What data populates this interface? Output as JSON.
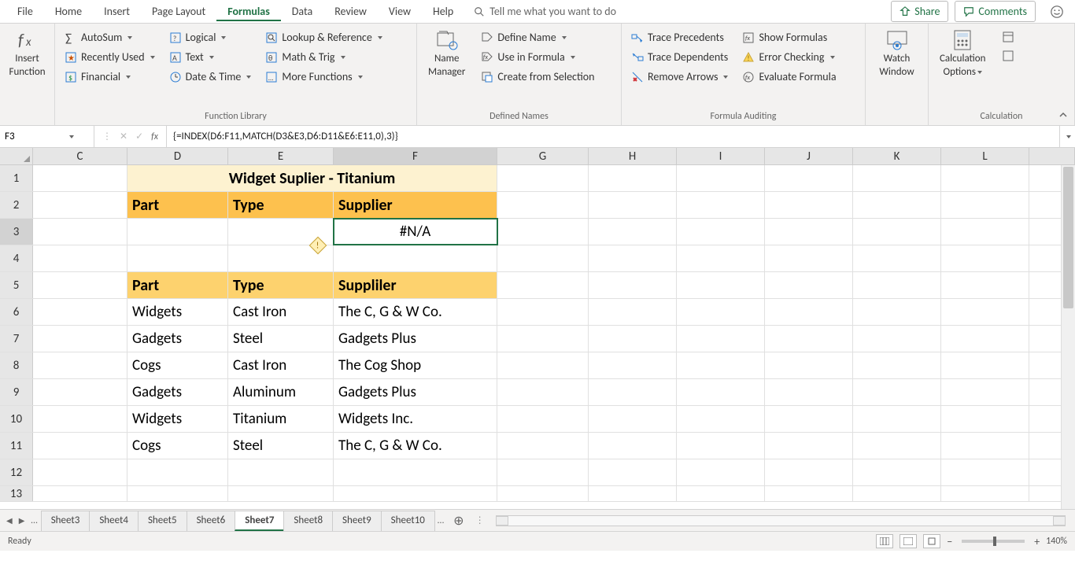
{
  "menu": {
    "file": "File",
    "home": "Home",
    "insert": "Insert",
    "page_layout": "Page Layout",
    "formulas": "Formulas",
    "data": "Data",
    "review": "Review",
    "view": "View",
    "help": "Help",
    "tellme": "Tell me what you want to do",
    "share": "Share",
    "comments": "Comments"
  },
  "ribbon": {
    "insert_func_l1": "Insert",
    "insert_func_l2": "Function",
    "autosum": "AutoSum",
    "recent": "Recently Used",
    "financial": "Financial",
    "logical": "Logical",
    "text": "Text",
    "datetime": "Date & Time",
    "lookup": "Lookup & Reference",
    "mathtrig": "Math & Trig",
    "morefunc": "More Functions",
    "group_funclib": "Function Library",
    "name_mgr_l1": "Name",
    "name_mgr_l2": "Manager",
    "define_name": "Define Name",
    "use_formula": "Use in Formula",
    "create_sel": "Create from Selection",
    "group_defnames": "Defined Names",
    "trace_prec": "Trace Precedents",
    "trace_dep": "Trace Dependents",
    "remove_arrows": "Remove Arrows",
    "show_formulas": "Show Formulas",
    "error_check": "Error Checking",
    "eval_formula": "Evaluate Formula",
    "group_audit": "Formula Auditing",
    "watch_l1": "Watch",
    "watch_l2": "Window",
    "calc_l1": "Calculation",
    "calc_l2": "Options",
    "group_calc": "Calculation"
  },
  "formula_bar": {
    "cell_ref": "F3",
    "formula": "{=INDEX(D6:F11,MATCH(D3&E3,D6:D11&E6:E11,0),3)}"
  },
  "cols": [
    "C",
    "D",
    "E",
    "F",
    "G",
    "H",
    "I",
    "J",
    "K",
    "L"
  ],
  "grid": {
    "title": "Widget Suplier - Titanium",
    "hdr_part": "Part",
    "hdr_type": "Type",
    "hdr_supplier": "Supplier",
    "f3": "#N/A",
    "tbl_hdr_part": "Part",
    "tbl_hdr_type": "Type",
    "tbl_hdr_suppliler": "Suppliler",
    "r6": {
      "d": "Widgets",
      "e": "Cast Iron",
      "f": "The C, G & W Co."
    },
    "r7": {
      "d": "Gadgets",
      "e": "Steel",
      "f": "Gadgets Plus"
    },
    "r8": {
      "d": "Cogs",
      "e": "Cast Iron",
      "f": "The Cog Shop"
    },
    "r9": {
      "d": "Gadgets",
      "e": "Aluminum",
      "f": "Gadgets Plus"
    },
    "r10": {
      "d": "Widgets",
      "e": "Titanium",
      "f": "Widgets Inc."
    },
    "r11": {
      "d": "Cogs",
      "e": "Steel",
      "f": "The C, G & W Co."
    }
  },
  "tabs": [
    "Sheet3",
    "Sheet4",
    "Sheet5",
    "Sheet6",
    "Sheet7",
    "Sheet8",
    "Sheet9",
    "Sheet10"
  ],
  "active_tab": 4,
  "status": {
    "ready": "Ready",
    "zoom": "140%"
  }
}
